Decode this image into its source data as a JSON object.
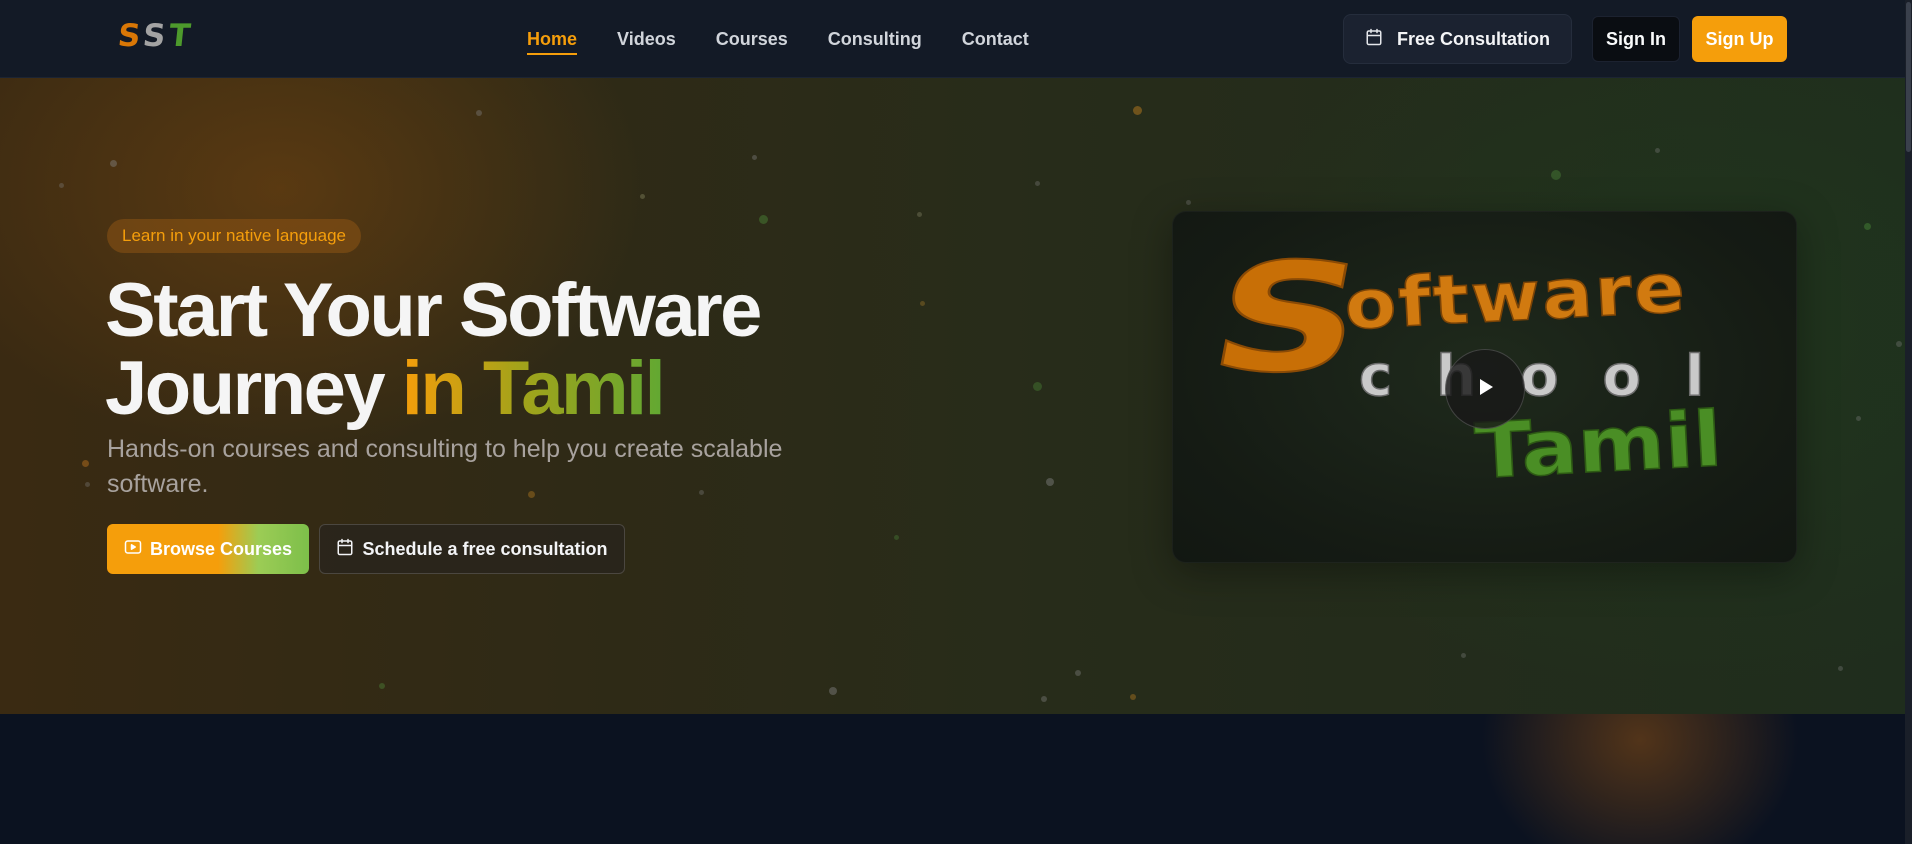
{
  "brand": {
    "logo_letters": [
      "S",
      "S",
      "T"
    ]
  },
  "nav": {
    "links": [
      {
        "label": "Home",
        "active": true
      },
      {
        "label": "Videos",
        "active": false
      },
      {
        "label": "Courses",
        "active": false
      },
      {
        "label": "Consulting",
        "active": false
      },
      {
        "label": "Contact",
        "active": false
      }
    ],
    "consult_label": "Free Consultation",
    "signin_label": "Sign In",
    "signup_label": "Sign Up"
  },
  "hero": {
    "badge": "Learn in your native language",
    "headline_line1": "Start Your Software",
    "headline_line2_plain": "Journey ",
    "headline_line2_accent": "in Tamil",
    "subtext": "Hands-on courses and consulting to help you create scalable software.",
    "browse_label": "Browse Courses",
    "schedule_label": "Schedule a free consultation"
  },
  "video": {
    "thumbnail_text": {
      "line1_initial": "S",
      "line1_rest": "oftware",
      "line2": "chool",
      "line3": "Tamil"
    },
    "play_icon": "play-icon"
  },
  "icons": {
    "calendar": "calendar-icon",
    "video": "video-icon"
  },
  "colors": {
    "accent_orange": "#f59e0b",
    "accent_green": "#62a832",
    "nav_bg": "#131a26",
    "page_bg": "#0b1220"
  }
}
